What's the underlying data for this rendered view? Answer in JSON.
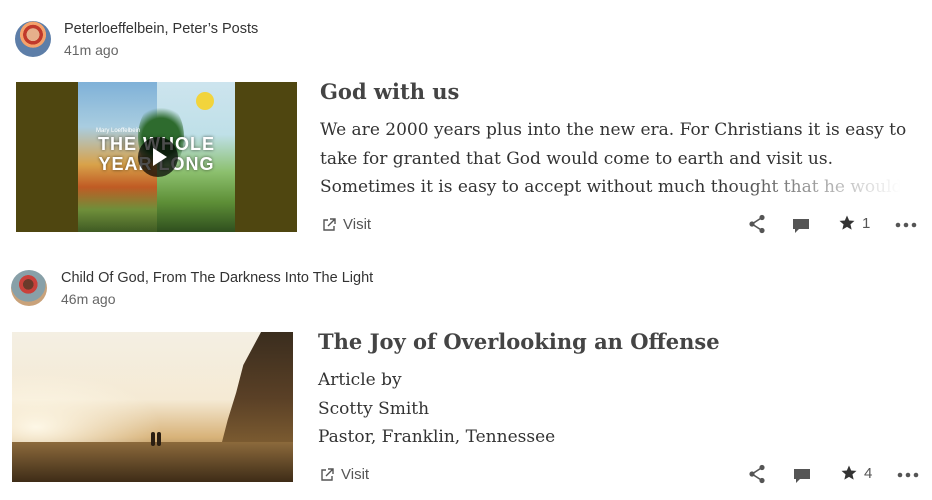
{
  "posts": [
    {
      "author": "Peterloeffelbein, Peter’s Posts",
      "time": "41m ago",
      "title": "God with us",
      "excerpt_lines": [
        "We are 2000 years plus into the new era. For Christians it is easy to",
        "take for granted that God would come to earth and visit us.",
        "Sometimes it is easy to accept without much thought that he would"
      ],
      "thumbnail": {
        "book_title": "THE WHOLE YEAR LONG",
        "book_author": "Mary Loeffelbein",
        "has_play_button": true
      },
      "visit_label": "Visit",
      "star_count": "1"
    },
    {
      "author": "Child Of God, From The Darkness Into The Light",
      "time": "46m ago",
      "title": "The Joy of Overlooking an Offense",
      "excerpt_lines": [
        "Article by",
        "Scotty Smith",
        "Pastor, Franklin, Tennessee"
      ],
      "visit_label": "Visit",
      "star_count": "4"
    }
  ],
  "icons": {
    "visit": "external-link-icon",
    "share": "share-icon",
    "comment": "comment-icon",
    "star": "star-icon",
    "more": "more-icon"
  },
  "colors": {
    "text": "#333333",
    "muted": "#666666",
    "icon": "#555555"
  }
}
